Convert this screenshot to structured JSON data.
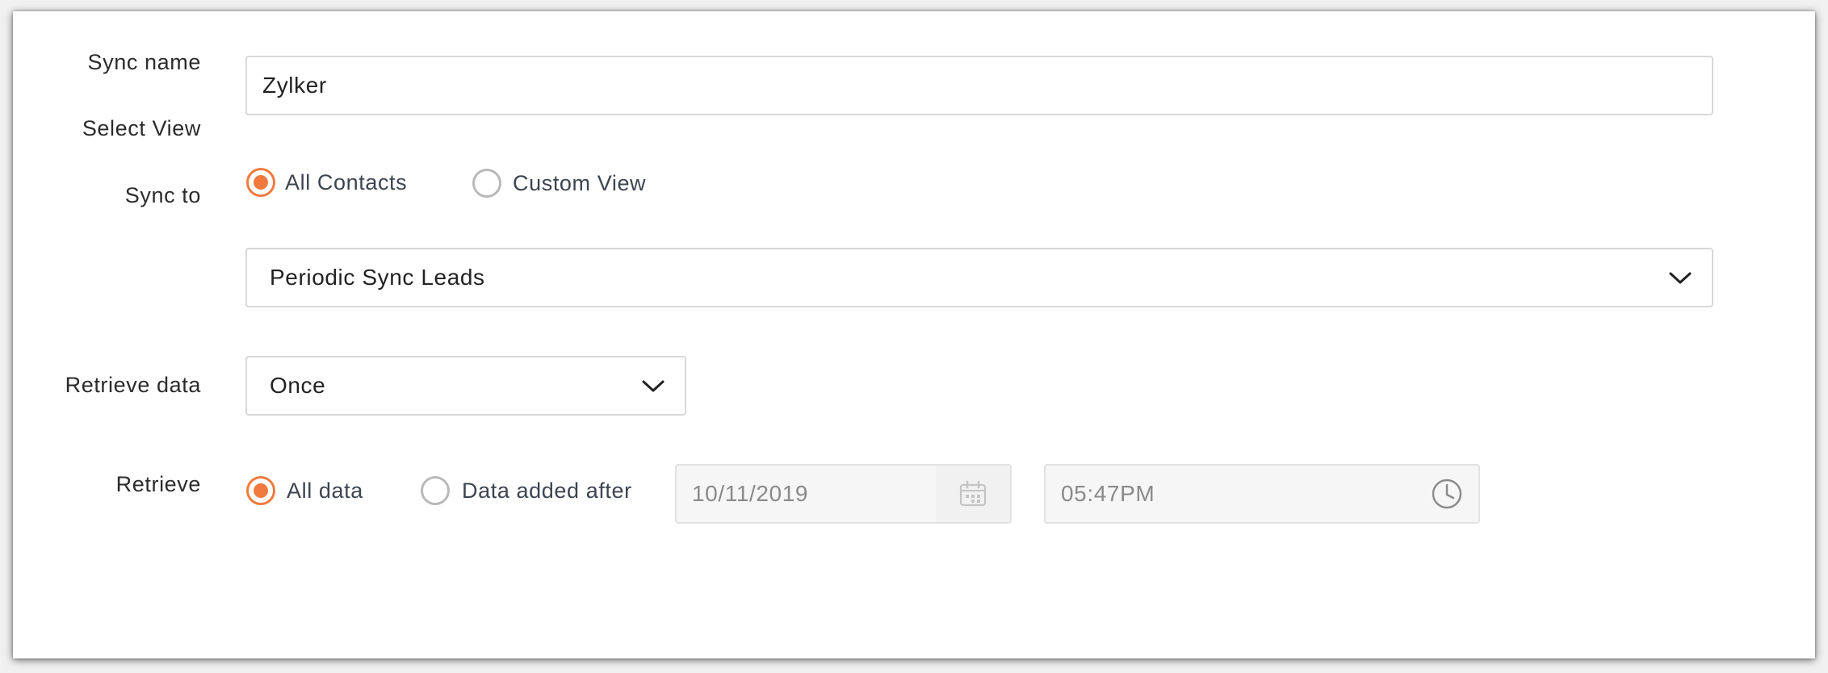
{
  "form": {
    "sync_name": {
      "label": "Sync name",
      "value": "Zylker"
    },
    "select_view": {
      "label": "Select View",
      "options": [
        {
          "label": "All Contacts",
          "selected": true
        },
        {
          "label": "Custom View",
          "selected": false
        }
      ]
    },
    "sync_to": {
      "label": "Sync to",
      "value": "Periodic Sync Leads"
    },
    "retrieve_data": {
      "label": "Retrieve data",
      "value": "Once"
    },
    "retrieve": {
      "label": "Retrieve",
      "options": [
        {
          "label": "All data",
          "selected": true
        },
        {
          "label": "Data added after",
          "selected": false
        }
      ],
      "date": "10/11/2019",
      "time": "05:47PM"
    }
  },
  "icons": {
    "dropdown": "chevron-down-icon",
    "date": "calendar-icon",
    "time": "clock-icon"
  },
  "colors": {
    "accent": "#f07a3e",
    "border": "#d8d8d8",
    "disabled_bg": "#f6f6f6"
  }
}
